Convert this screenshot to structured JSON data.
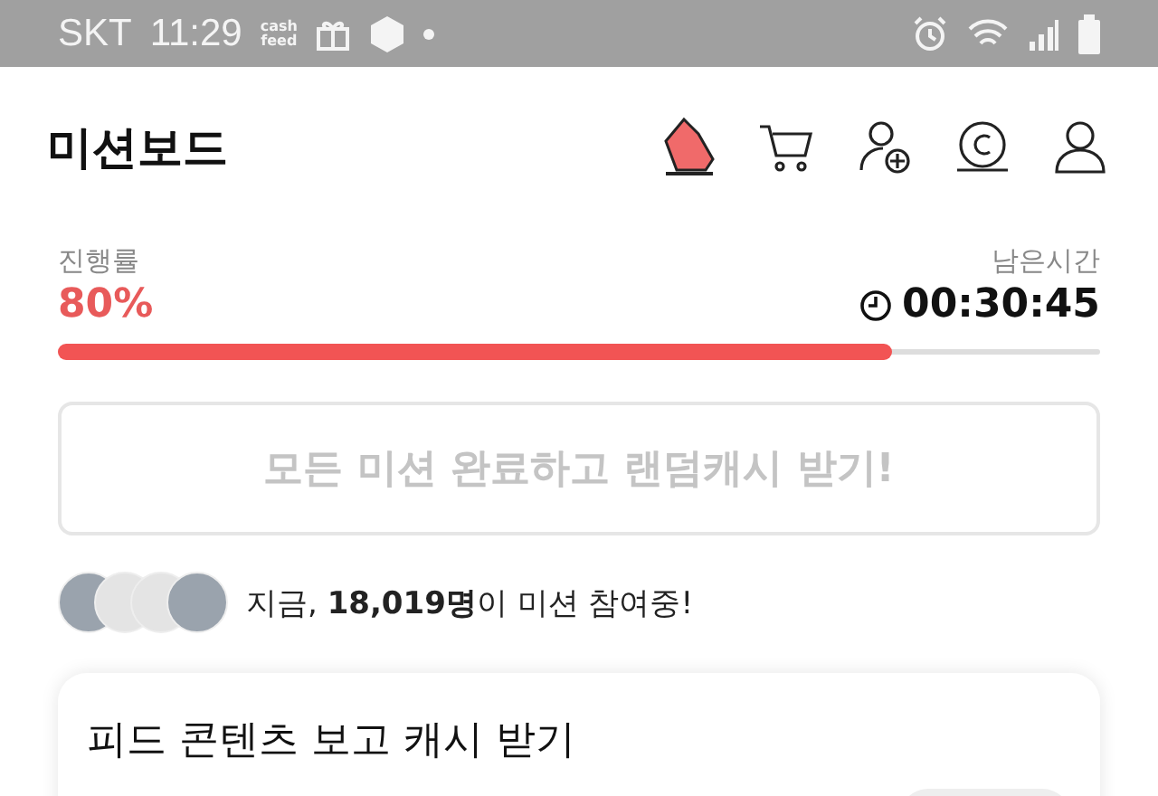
{
  "status_bar": {
    "carrier": "SKT",
    "time": "11:29",
    "app_logo": [
      "cash",
      "feed"
    ]
  },
  "header": {
    "title": "미션보드"
  },
  "progress": {
    "label": "진행률",
    "value": "80%",
    "level": 0.8,
    "time_label": "남은시간",
    "time": "00:30:45"
  },
  "reward_button": {
    "label": "모든 미션 완료하고 랜덤캐시 받기!",
    "disabled": true
  },
  "participants": {
    "avatars": [
      {
        "kind": "photo"
      },
      {
        "kind": "blank"
      },
      {
        "kind": "blank"
      },
      {
        "kind": "photo"
      }
    ],
    "text": "지금, **18,019명**이 미션 참여중!"
  },
  "mission_card": {
    "title": "피드 콘텐츠 보고 캐시 받기"
  }
}
